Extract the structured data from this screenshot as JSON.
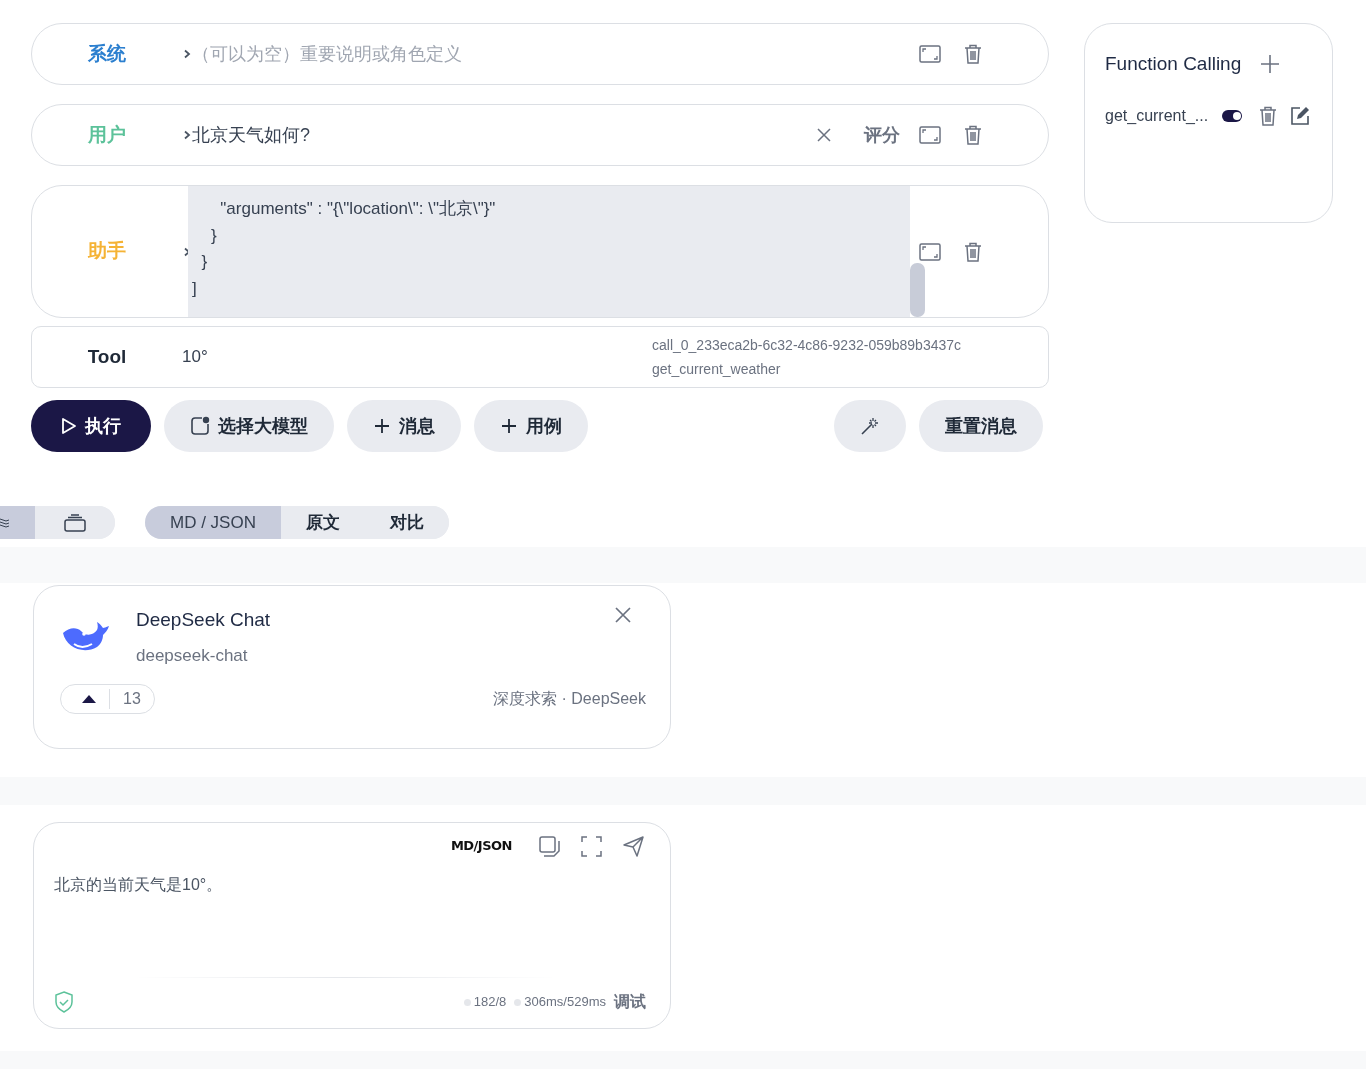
{
  "messages": [
    {
      "role": "系统",
      "kind": "system",
      "placeholder": "（可以为空）重要说明或角色定义"
    },
    {
      "role": "用户",
      "kind": "user",
      "text": "北京天气如何?",
      "clearable": true,
      "score_label": "评分"
    },
    {
      "role": "助手",
      "kind": "assistant",
      "code_lines": [
        "      \"arguments\" : \"{\\\"location\\\": \\\"北京\\\"}\"",
        "    }",
        "  }",
        "]"
      ]
    },
    {
      "role": "Tool",
      "kind": "tool",
      "text": "10°",
      "call_id": "call_0_233eca2b-6c32-4c86-9232-059b89b3437c",
      "function": "get_current_weather"
    }
  ],
  "toolbar": {
    "buttons": [
      {
        "label": "执行",
        "kind": "run"
      },
      {
        "label": "选择大模型",
        "kind": "model"
      },
      {
        "label": "消息",
        "kind": "add"
      },
      {
        "label": "用例",
        "kind": "add"
      }
    ],
    "reset_label": "重置消息"
  },
  "function_calling": {
    "title": "Function Calling",
    "functions": [
      {
        "name": "get_current_...",
        "on": true
      }
    ]
  },
  "layout_switch": [
    {
      "kind": "lines",
      "selected": true
    },
    {
      "kind": "stack",
      "selected": false
    }
  ],
  "view_tabs": [
    {
      "label": "MD / JSON",
      "selected": true
    },
    {
      "label": "原文",
      "selected": false
    },
    {
      "label": "对比",
      "selected": false
    }
  ],
  "model_card": {
    "name": "DeepSeek Chat",
    "id": "deepseek-chat",
    "votes": "13",
    "vendor": "深度求索 · DeepSeek"
  },
  "response": {
    "format_label": "MD/JSON",
    "text": "北京的当前天气是10°。",
    "tokens": "182/8",
    "timing": "306ms/529ms",
    "debug_label": "调试"
  }
}
